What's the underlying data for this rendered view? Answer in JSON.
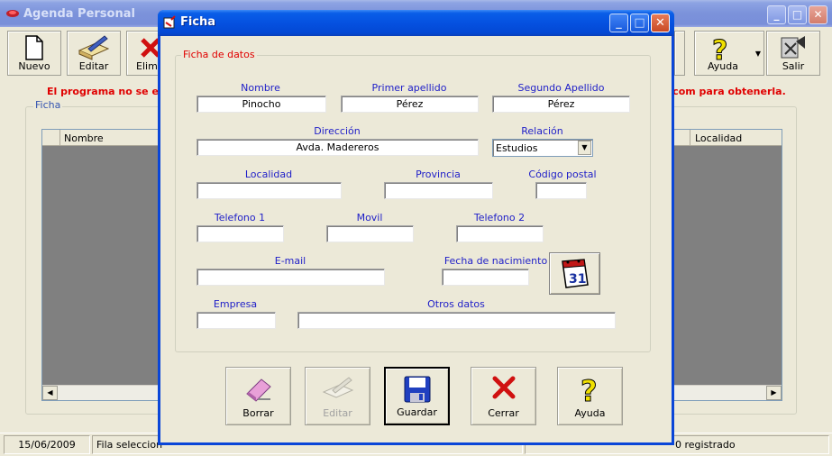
{
  "main_window": {
    "title": "Agenda Personal",
    "toolbar": {
      "nuevo": "Nuevo",
      "editar": "Editar",
      "eliminar": "Elimin",
      "ayuda": "Ayuda",
      "salir": "Salir"
    },
    "banner_left": "El programa no se enc",
    "banner_right": ".com para obtenerla.",
    "group_label": "Ficha",
    "grid_columns": {
      "nombre": "Nombre",
      "localidad": "Localidad"
    },
    "status": {
      "date": "15/06/2009",
      "fila": "Fila seleccion",
      "registro": "0 registrado"
    }
  },
  "dialog": {
    "title": "Ficha",
    "group_label": "Ficha de datos",
    "labels": {
      "nombre": "Nombre",
      "primer_apellido": "Primer apellido",
      "segundo_apellido": "Segundo Apellido",
      "direccion": "Dirección",
      "relacion": "Relación",
      "localidad": "Localidad",
      "provincia": "Provincia",
      "codigo_postal": "Código postal",
      "telefono1": "Telefono 1",
      "movil": "Movil",
      "telefono2": "Telefono 2",
      "email": "E-mail",
      "fecha_nacimiento": "Fecha de nacimiento",
      "empresa": "Empresa",
      "otros_datos": "Otros datos"
    },
    "values": {
      "nombre": "Pinocho",
      "primer_apellido": "Pérez",
      "segundo_apellido": "Pérez",
      "direccion": "Avda. Madereros",
      "relacion": "Estudios",
      "localidad": "",
      "provincia": "",
      "codigo_postal": "",
      "telefono1": "",
      "movil": "",
      "telefono2": "",
      "email": "",
      "fecha_nacimiento": "",
      "empresa": "",
      "otros_datos": ""
    },
    "calendar_day": "31",
    "buttons": {
      "borrar": "Borrar",
      "editar": "Editar",
      "guardar": "Guardar",
      "cerrar": "Cerrar",
      "ayuda": "Ayuda"
    }
  },
  "colors": {
    "window_bg": "#ece9d8",
    "active_title": "#0551e0",
    "inactive_title": "#7b92da",
    "label_blue": "#1e1ec8",
    "banner_red": "#e00000"
  }
}
